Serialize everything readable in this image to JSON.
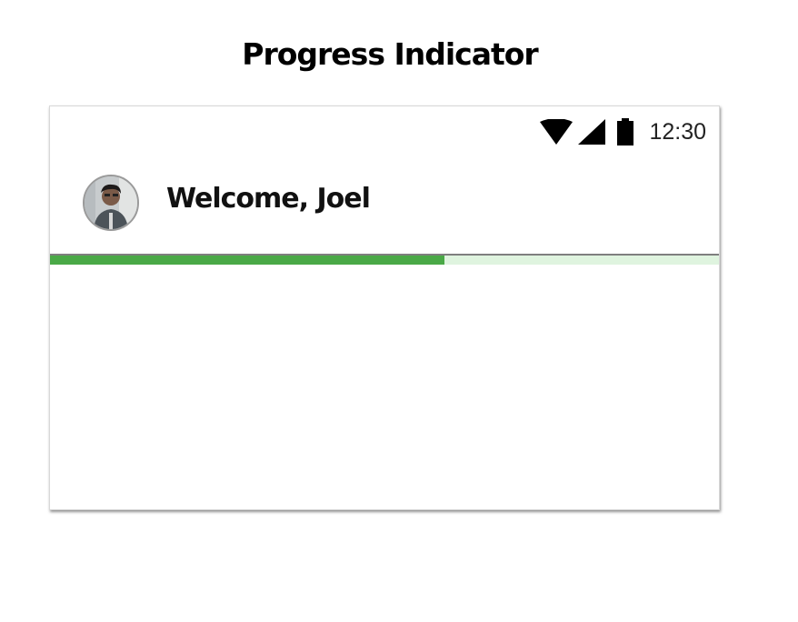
{
  "page": {
    "heading": "Progress Indicator"
  },
  "status_bar": {
    "time": "12:30",
    "icons": [
      "wifi-icon",
      "cell-signal-icon",
      "battery-icon"
    ]
  },
  "header": {
    "avatar_icon": "user-avatar",
    "welcome": "Welcome, Joel"
  },
  "progress": {
    "value": 0.59,
    "fill_color": "#4aa947",
    "track_color": "#dff4df"
  }
}
